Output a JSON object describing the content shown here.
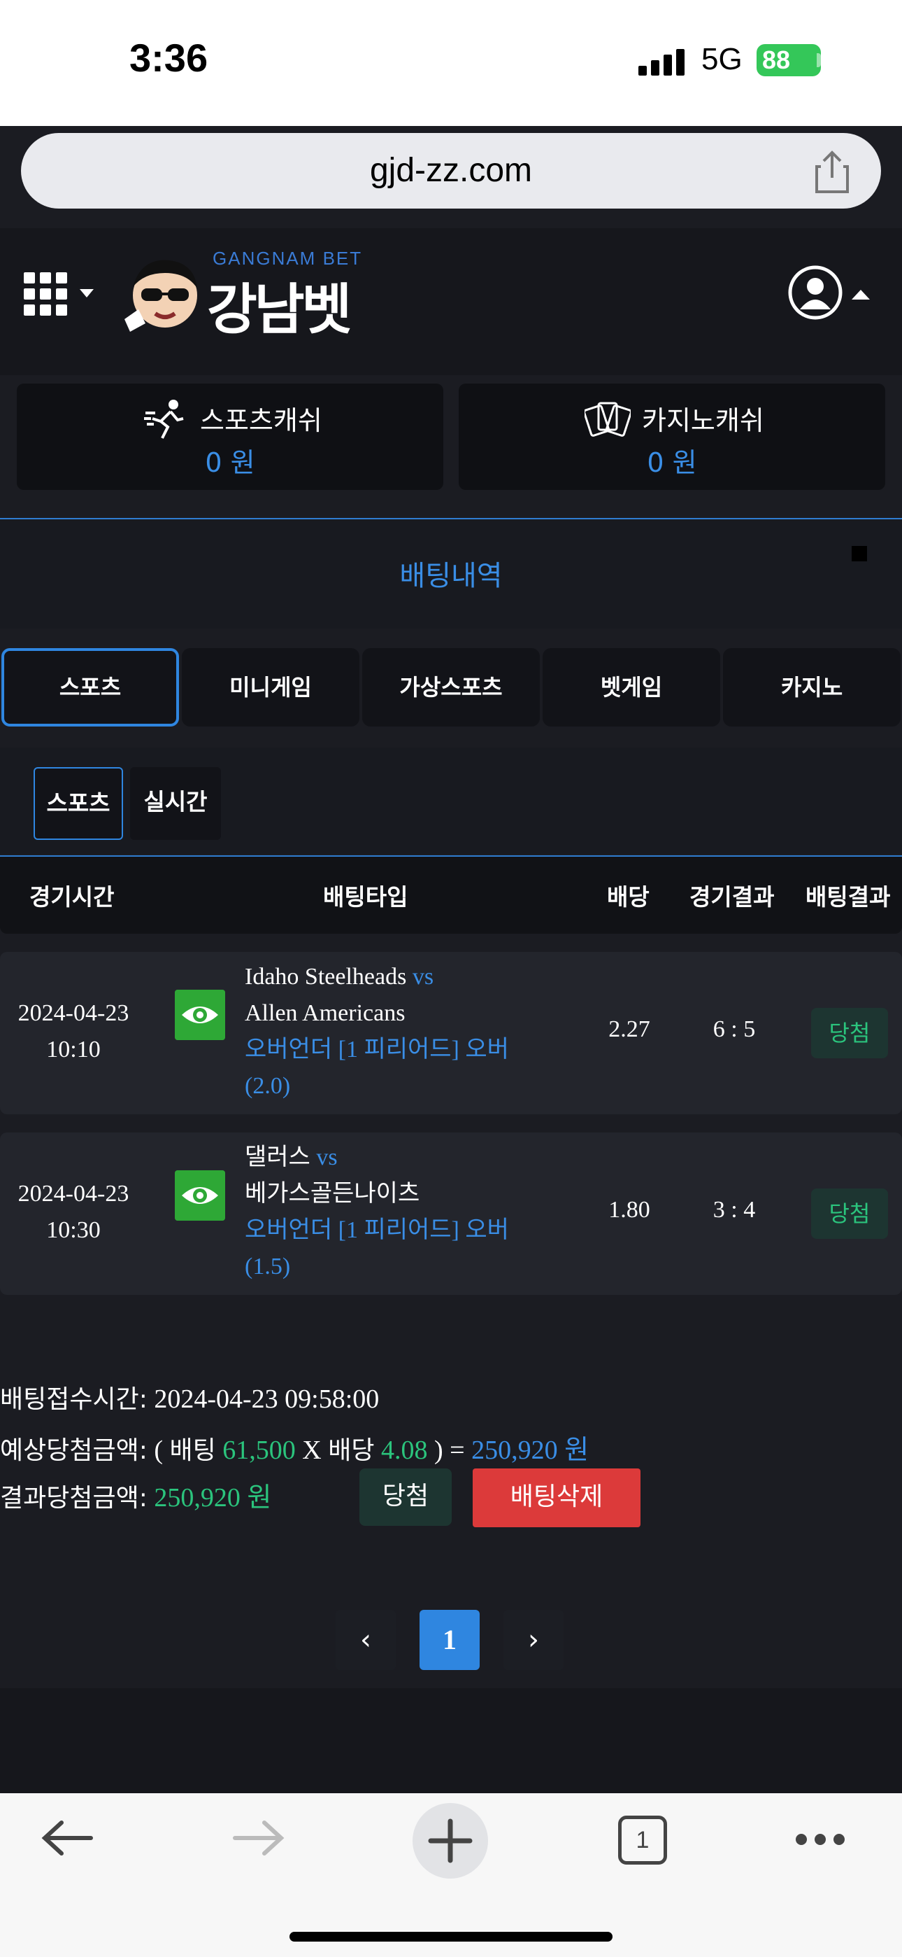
{
  "status_bar": {
    "time": "3:36",
    "network": "5G",
    "battery": "88"
  },
  "browser": {
    "url": "gjd-zz.com"
  },
  "header": {
    "logo_sub": "GANGNAM BET",
    "logo_main": "강남벳"
  },
  "cash": {
    "sports": {
      "label": "스포츠캐쉬",
      "value": "0 원"
    },
    "casino": {
      "label": "카지노캐쉬",
      "value": "0 원"
    }
  },
  "section_title": "배팅내역",
  "tabs": [
    "스포츠",
    "미니게임",
    "가상스포츠",
    "벳게임",
    "카지노"
  ],
  "subtabs": [
    "스포츠",
    "실시간"
  ],
  "table": {
    "headers": [
      "경기시간",
      "배팅타입",
      "배당",
      "경기결과",
      "배팅결과"
    ],
    "rows": [
      {
        "date": "2024-04-23",
        "time": "10:10",
        "home": "Idaho Steelheads",
        "vs": "vs",
        "away": "Allen Americans",
        "bet_type": "오버언더 [1 피리어드] 오버",
        "line": "(2.0)",
        "odds": "2.27",
        "score": "6 : 5",
        "result": "당첨"
      },
      {
        "date": "2024-04-23",
        "time": "10:30",
        "home": "댈러스",
        "vs": "vs",
        "away": "베가스골든나이츠",
        "bet_type": "오버언더 [1 피리어드] 오버",
        "line": "(1.5)",
        "odds": "1.80",
        "score": "3 : 4",
        "result": "당첨"
      }
    ]
  },
  "summary": {
    "received_label": "배팅접수시간:",
    "received_value": "2024-04-23 09:58:00",
    "expected_label": "예상당첨금액:",
    "open_paren": "(",
    "bet_label": "배팅",
    "bet_amount": "61,500",
    "times": "X",
    "odds_label": "배당",
    "odds_value": "4.08",
    "close_eq": ") =",
    "expected_amount": "250,920 원",
    "result_label": "결과당첨금액:",
    "result_amount": "250,920 원",
    "win_button": "당첨",
    "delete_button": "배팅삭제"
  },
  "pagination": {
    "prev": "‹",
    "current": "1",
    "next": "›"
  },
  "toolbar": {
    "tab_count": "1"
  },
  "colors": {
    "accent": "#2f86e0",
    "win_green": "#2bc47d",
    "delete_red": "#dc3a3a",
    "background": "#1b1c22"
  }
}
